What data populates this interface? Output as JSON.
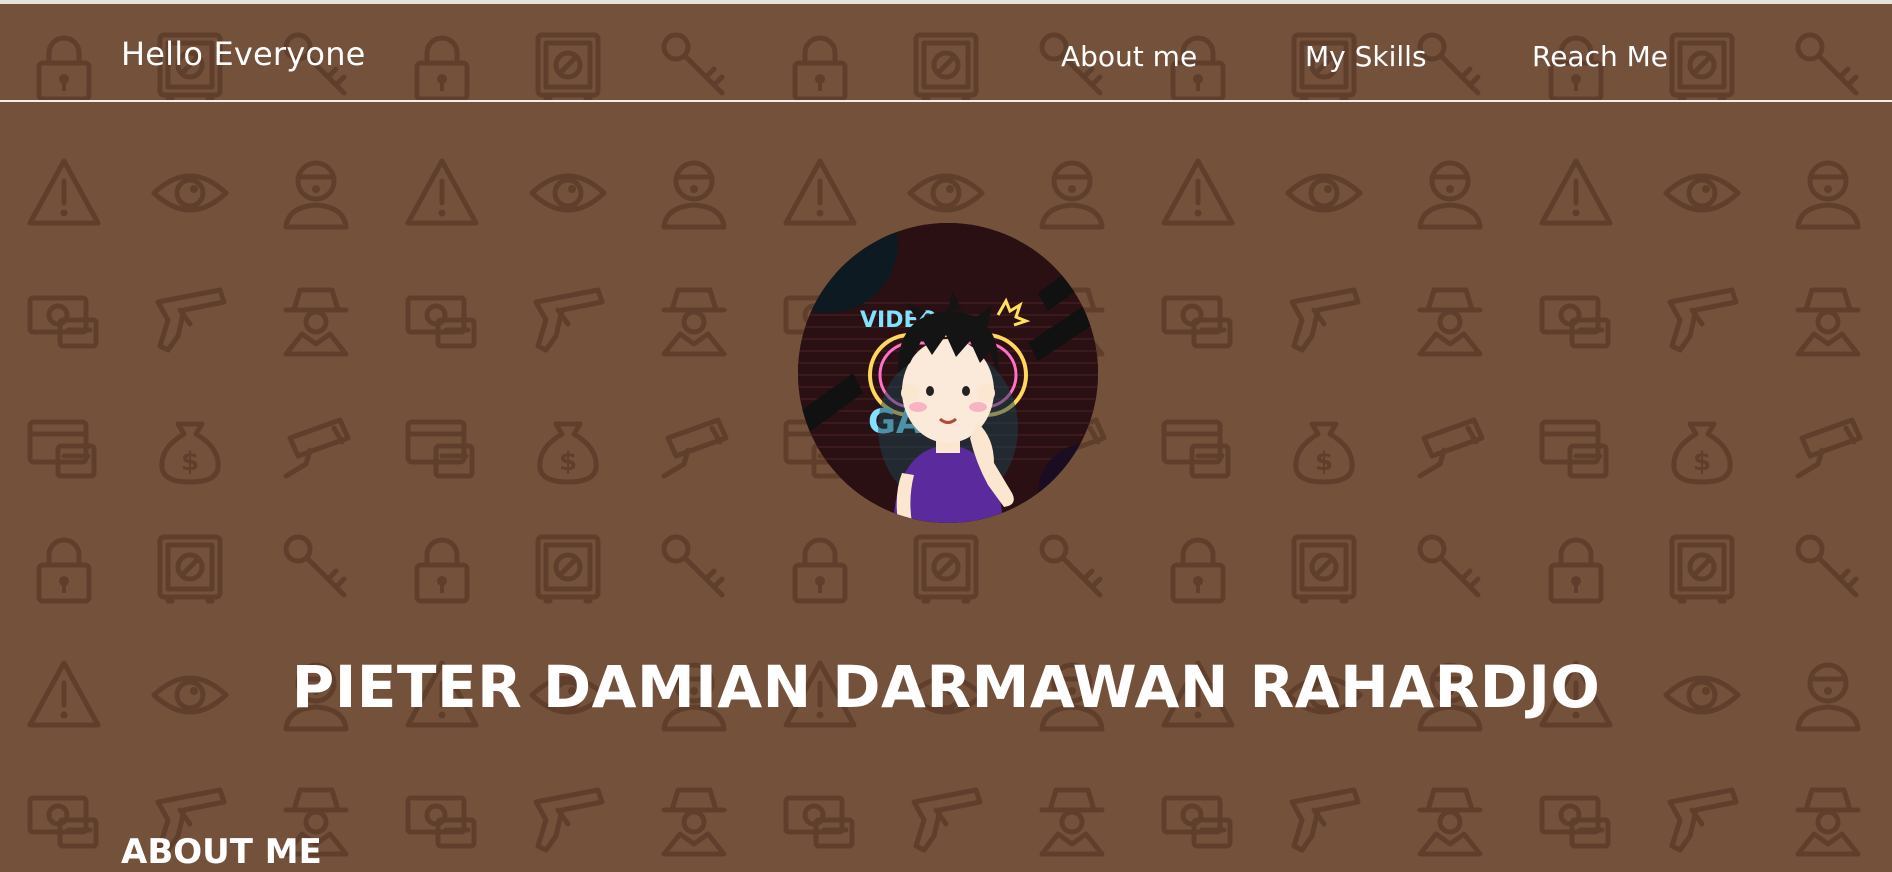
{
  "nav": {
    "brand": "Hello Everyone",
    "links": [
      {
        "label": "About me"
      },
      {
        "label": "My Skills"
      },
      {
        "label": "Reach Me"
      }
    ]
  },
  "hero": {
    "avatar_icon": "gamer-avatar-icon",
    "name": "PIETER DAMIAN DARMAWAN RAHARDJO"
  },
  "about": {
    "heading": "ABOUT ME"
  },
  "background": {
    "icons": [
      "padlock-icon",
      "safe-icon",
      "key-icon",
      "warning-icon",
      "eye-icon",
      "thief-icon",
      "money-icon",
      "gun-icon",
      "spy-icon",
      "credit-card-icon",
      "money-bag-icon",
      "camera-icon"
    ],
    "color": "#74513a",
    "pattern_color": "#5f3f2c"
  }
}
